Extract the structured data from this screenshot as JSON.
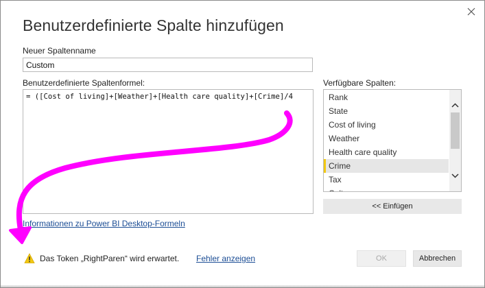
{
  "dialog": {
    "title": "Benutzerdefinierte Spalte hinzufügen",
    "close_icon": "close-icon"
  },
  "column_name": {
    "label": "Neuer Spaltenname",
    "value": "Custom"
  },
  "formula": {
    "label": "Benutzerdefinierte Spaltenformel:",
    "text": "= ([Cost of living]+[Weather]+[Health care quality]+[Crime]/4"
  },
  "available_columns": {
    "label": "Verfügbare Spalten:",
    "items": [
      "Rank",
      "State",
      "Cost of living",
      "Weather",
      "Health care quality",
      "Crime",
      "Tax",
      "Culture"
    ],
    "selected": "Crime",
    "selection_accent": "#f2c811"
  },
  "insert_button": {
    "label": "<< Einfügen"
  },
  "help_link": {
    "label": "Informationen zu Power BI Desktop-Formeln"
  },
  "status": {
    "icon": "warning-icon",
    "message": "Das Token „RightParen“ wird erwartet.",
    "show_error_link": "Fehler anzeigen",
    "warning_color": "#f2c811"
  },
  "buttons": {
    "ok": "OK",
    "cancel": "Abbrechen"
  },
  "annotation": {
    "arrow_color": "#ff00ff"
  }
}
